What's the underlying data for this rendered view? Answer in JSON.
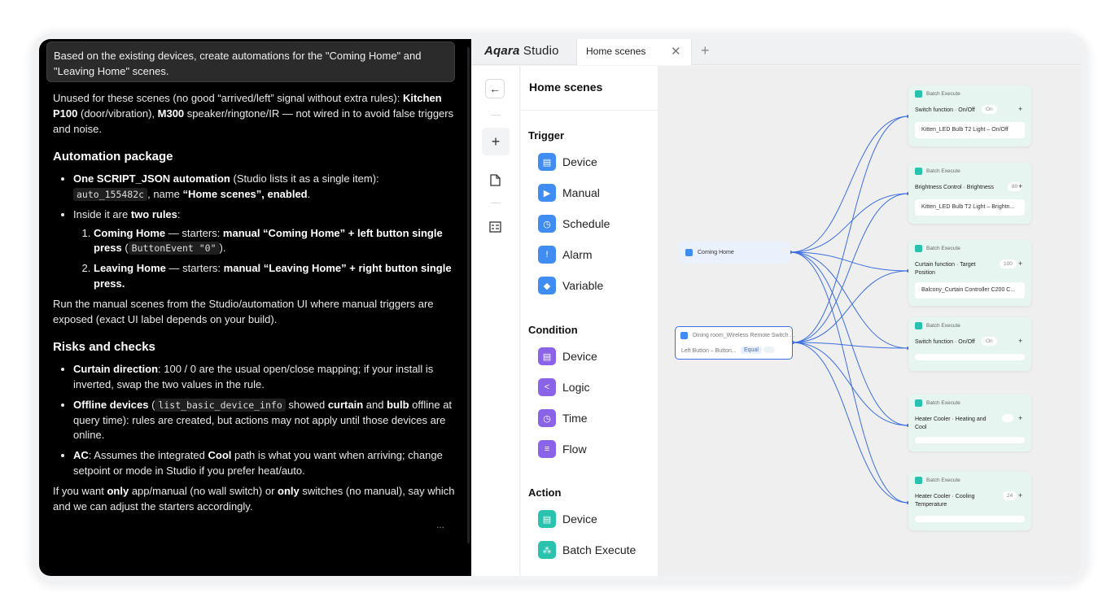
{
  "chat": {
    "prompt": "Based on the existing devices, create automations for the \"Coming Home\" and \"Leaving Home\" scenes.",
    "p1_pre": "Unused for these scenes (no good “arrived/left” signal without extra rules): ",
    "p1_b1": "Kitchen P100",
    "p1_mid": " (door/vibration), ",
    "p1_b2": "M300",
    "p1_post": " speaker/ringtone/IR — not wired in to avoid false triggers and noise.",
    "h_auto": "Automation package",
    "li1_b": "One SCRIPT_JSON automation",
    "li1_t1": " (Studio lists it as a single item): ",
    "li1_code": "auto_155482c",
    "li1_t2": ", name ",
    "li1_b2": "“Home scenes”, enabled",
    "li1_t3": ".",
    "li2_t": "Inside it are ",
    "li2_b": "two rules",
    "li2_end": ":",
    "ol1_b": "Coming Home",
    "ol1_t": " — starters: ",
    "ol1_b2": "manual “Coming Home” + left button single press",
    "ol1_t2": " (",
    "ol1_code": "ButtonEvent  \"0\"",
    "ol1_t3": ").",
    "ol2_b": "Leaving Home",
    "ol2_t": " — starters: ",
    "ol2_b2": "manual “Leaving Home” + right button single press.",
    "p2": "Run the manual scenes from the Studio/automation UI where manual triggers are exposed (exact UI label depends on your build).",
    "h_risk": "Risks and checks",
    "r1_b": "Curtain direction",
    "r1_t": ": 100 / 0 are the usual open/close mapping; if your install is inverted, swap the two values in the rule.",
    "r2_b": "Offline devices",
    "r2_t1": " (",
    "r2_code": "list_basic_device_info",
    "r2_t2": " showed ",
    "r2_b2": "curtain",
    "r2_t3": " and ",
    "r2_b3": "bulb",
    "r2_t4": " offline at query time): rules are created, but actions may not apply until those devices are online.",
    "r3_b": "AC",
    "r3_t1": ": Assumes the integrated ",
    "r3_b2": "Cool",
    "r3_t2": " path is what you want when arriving; change setpoint or mode in Studio if you prefer heat/auto.",
    "p3_t1": "If you want ",
    "p3_b1": "only",
    "p3_t2": " app/manual (no wall switch) or ",
    "p3_b2": "only",
    "p3_t3": " switches (no manual), say which and we can adjust the starters accordingly.",
    "more": "..."
  },
  "app": {
    "logo_brand": "Aqara",
    "logo_product": "Studio",
    "tab_label": "Home scenes",
    "tab_close": "✕",
    "new_tab": "+",
    "panel_title": "Home scenes",
    "sections": {
      "trigger": "Trigger",
      "condition": "Condition",
      "action": "Action"
    },
    "trigger_items": [
      "Device",
      "Manual",
      "Schedule",
      "Alarm",
      "Variable"
    ],
    "condition_items": [
      "Device",
      "Logic",
      "Time",
      "Flow"
    ],
    "action_items": [
      "Device",
      "Batch Execute"
    ]
  },
  "canvas": {
    "triggers": [
      {
        "name": "Coming Home"
      },
      {
        "name": "Dining room_Wireless Remote Switch ...",
        "sub": "Left Button – Button...",
        "op": "Equal"
      }
    ],
    "nodes": [
      {
        "header": "Batch Execute",
        "fn": "Switch function · On/Off",
        "val": "On",
        "device": "Kitten_LED Bulb T2 Light – On/Off"
      },
      {
        "header": "Batch Execute",
        "fn": "Brightness Control · Brightness",
        "val": "80",
        "device": "Kitten_LED Bulb T2 Light – Brightn..."
      },
      {
        "header": "Batch Execute",
        "fn": "Curtain function · Target Position",
        "val": "100",
        "device": "Balcony_Curtain Controller C200 C..."
      },
      {
        "header": "Batch Execute",
        "fn": "Switch function · On/Off",
        "val": "On",
        "device": ""
      },
      {
        "header": "Batch Execute",
        "fn": "Heater Cooler · Heating and Cool",
        "val": "",
        "device": ""
      },
      {
        "header": "Batch Execute",
        "fn": "Heater Cooler · Cooling Temperature",
        "val": "24",
        "device": ""
      }
    ],
    "plus": "+"
  },
  "colors": {
    "wire": "#3b6ee0",
    "node_bg": "#e7f5f0",
    "accent": "#3f8cf2"
  }
}
